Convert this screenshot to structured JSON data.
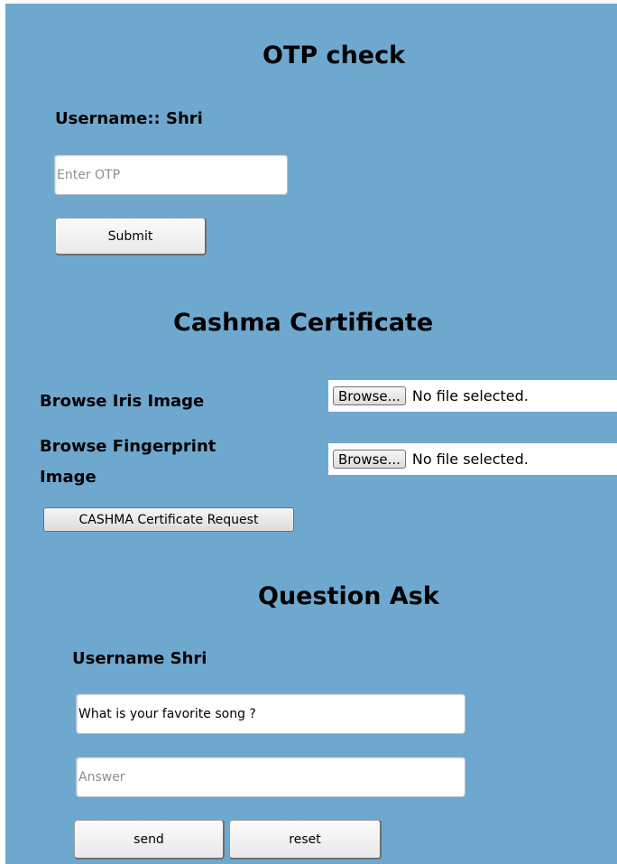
{
  "otp_section": {
    "title": "OTP check",
    "username_label": "Username:: Shri",
    "otp_placeholder": "Enter OTP",
    "submit_label": "Submit"
  },
  "cashma_section": {
    "title": "Cashma Certificate",
    "iris_label": "Browse Iris Image",
    "fingerprint_label_line1": "Browse Fingerprint",
    "fingerprint_label_line2": "Image",
    "iris_browse_label": "Browse...",
    "iris_file_status": "No file selected.",
    "fingerprint_browse_label": "Browse...",
    "fingerprint_file_status": "No file selected.",
    "request_button_label": "CASHMA Certificate Request"
  },
  "question_section": {
    "title": "Question Ask",
    "username_label": "Username Shri",
    "question_value": "What is your favorite song ?",
    "answer_placeholder": "Answer",
    "send_label": "send",
    "reset_label": "reset"
  },
  "colors": {
    "panel_background": "#6fa8cf",
    "page_background": "#ffffff"
  }
}
